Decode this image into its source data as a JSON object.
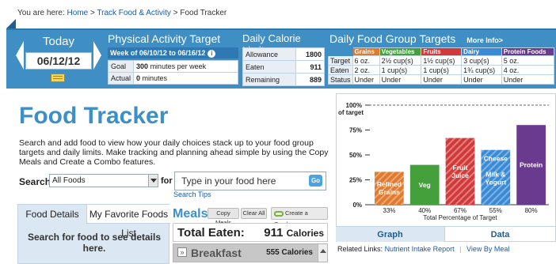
{
  "breadcrumb": {
    "prefix": "You are here:",
    "home": "Home",
    "sep1": ">",
    "track": "Track Food & Activity",
    "sep2": ">",
    "current": "Food Tracker"
  },
  "today": {
    "label": "Today",
    "date": "06/12/12"
  },
  "physical_activity": {
    "title": "Physical Activity Target",
    "week": "Week of 06/10/12 to 06/16/12",
    "goal_label": "Goal",
    "goal_value": "300",
    "goal_unit": "minutes per week",
    "actual_label": "Actual",
    "actual_value": "0",
    "actual_unit": "minutes"
  },
  "calorie_limit": {
    "title": "Daily Calorie Limit",
    "rows": [
      {
        "label": "Allowance",
        "value": "1800"
      },
      {
        "label": "Eaten",
        "value": "911"
      },
      {
        "label": "Remaining",
        "value": "889"
      }
    ]
  },
  "food_groups": {
    "title": "Daily Food Group Targets",
    "more_info": "More Info>",
    "headers": [
      "Grains",
      "Vegetables",
      "Fruits",
      "Dairy",
      "Protein Foods"
    ],
    "header_colors": [
      "#e07a2f",
      "#43a03a",
      "#d23a3a",
      "#3a8ad6",
      "#6a3a8e"
    ],
    "rows": [
      {
        "label": "Target",
        "cells": [
          "6 oz.",
          "2½ cup(s)",
          "1½ cup(s)",
          "3 cup(s)",
          "5 oz."
        ]
      },
      {
        "label": "Eaten",
        "cells": [
          "2 oz.",
          "1 cup(s)",
          "1 cup(s)",
          "1¾ cup(s)",
          "4 oz."
        ]
      },
      {
        "label": "Status",
        "cells": [
          "Under",
          "Under",
          "Under",
          "Under",
          "Under"
        ]
      }
    ]
  },
  "main": {
    "title": "Food Tracker",
    "intro": "Search and add food to view how your daily choices stack up to your food group targets and daily limits. Make tracking and planning ahead simple by using the Copy Meals and Create a Combo features.",
    "search_label": "Search:",
    "search_select": "All Foods",
    "for_label": "for",
    "search_placeholder": "Type in your food here",
    "go_label": "Go",
    "search_tips": "Search Tips"
  },
  "food_tabs": {
    "tab1": "Food Details",
    "tab2": "My Favorite Foods List",
    "message": "Search for food to see details here."
  },
  "meals": {
    "title": "Meals",
    "copy_meals": "Copy Meals",
    "clear_all": "Clear All",
    "create_combo": "Create a Combo",
    "total_label": "Total Eaten:",
    "total_value": "911",
    "total_unit": "Calories",
    "breakfast_label": "Breakfast",
    "breakfast_value": "555 Calories"
  },
  "chart_data": {
    "type": "bar",
    "title": "",
    "xlabel": "Total Percentage of Target",
    "ylabel": "of target",
    "y_ticks": [
      "100%",
      "75%",
      "50%",
      "25%",
      "0%"
    ],
    "ylim": [
      0,
      100
    ],
    "categories": [
      "Refined Grains",
      "Veg",
      "Fruit Juice",
      "Cheese / Milk & Yogurt",
      "Protein"
    ],
    "bar_labels": [
      [
        "Refined",
        "Grains"
      ],
      [
        "Veg"
      ],
      [
        "Fruit",
        "Juice"
      ],
      [
        "Cheese",
        "Milk &",
        "Yogurt"
      ],
      [
        "Protein"
      ]
    ],
    "values": [
      33,
      40,
      67,
      55,
      80
    ],
    "value_labels": [
      "33%",
      "40%",
      "67%",
      "55%",
      "80%"
    ],
    "colors": [
      "#e07a2f",
      "#43a03a",
      "#d23a3a",
      "#3a8ad6",
      "#6a3a8e"
    ],
    "hatched": [
      true,
      false,
      true,
      true,
      false
    ]
  },
  "chart_tabs": {
    "graph": "Graph",
    "data": "Data"
  },
  "related": {
    "label": "Related Links:",
    "link1": "Nutrient Intake Report",
    "sep": "|",
    "link2": "View By Meal"
  }
}
